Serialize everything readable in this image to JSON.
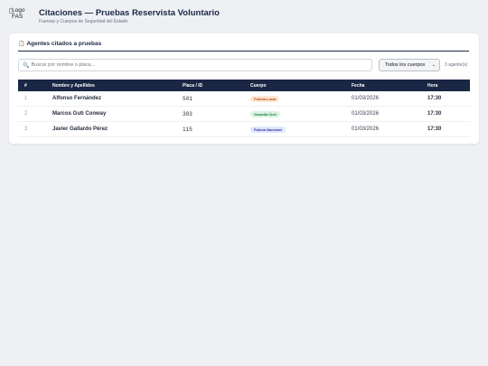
{
  "header": {
    "logo_alt": "Logo FAS",
    "title": "Citaciones — Pruebas Reservista Voluntario",
    "subtitle": "Fuerzas y Cuerpos de Seguridad del Estado"
  },
  "card": {
    "icon": "clipboard-icon",
    "title": "Agentes citados a pruebas"
  },
  "search": {
    "placeholder": "Buscar por nombre o placa..."
  },
  "filter": {
    "selected": "Todos los cuerpos",
    "count": "3 agente(s)"
  },
  "table": {
    "headers": [
      "#",
      "Nombre y Apellidos",
      "Placa / ID",
      "Cuerpo",
      "Fecha",
      "Hora"
    ],
    "rows": [
      {
        "num": "1",
        "name": "Alfonso Fernández",
        "plate": "501",
        "body": "Policía Local",
        "date": "01/03/2026",
        "hour": "17:30"
      },
      {
        "num": "2",
        "name": "Marcos Guti Conway",
        "plate": "303",
        "body": "Guardia Civil",
        "date": "01/03/2026",
        "hour": "17:30"
      },
      {
        "num": "3",
        "name": "Javier Gallardo Pérez",
        "plate": "115",
        "body": "Policía Nacional",
        "date": "01/03/2026",
        "hour": "17:30"
      }
    ]
  },
  "colors": {
    "navy": "#1a2744",
    "badge_local_bg": "#fde7d6",
    "badge_local_fg": "#c2410c",
    "badge_guardia_bg": "#dcf3e3",
    "badge_guardia_fg": "#15803d",
    "badge_nacional_bg": "#e0e7ff",
    "badge_nacional_fg": "#3730a3"
  }
}
